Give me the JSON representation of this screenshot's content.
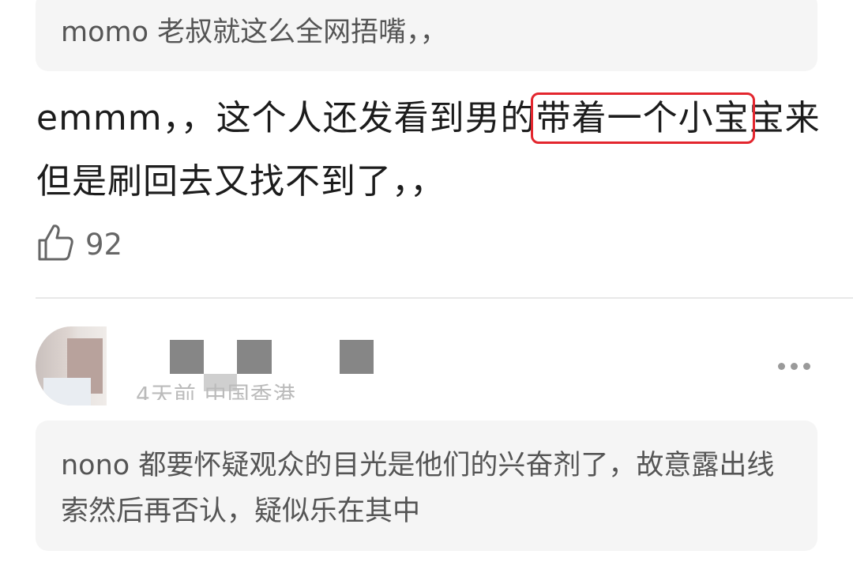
{
  "quoted_reply_top": {
    "text": "momo 老叔就这么全网捂嘴，，"
  },
  "comment": {
    "text_before": "emmm，，这个人还发看到男的",
    "text_highlight": "带着一个小宝",
    "text_after": "宝来但是刷回去又找不到了，，",
    "highlight_color": "#e3262e"
  },
  "like": {
    "icon": "thumbs-up-icon",
    "count": "92"
  },
  "next_comment": {
    "meta": "4天前 中国香港",
    "more_icon": "more-dots-icon"
  },
  "quoted_reply_bottom": {
    "text": "nono 都要怀疑观众的目光是他们的兴奋剂了，故意露出线索然后再否认，疑似乐在其中"
  }
}
